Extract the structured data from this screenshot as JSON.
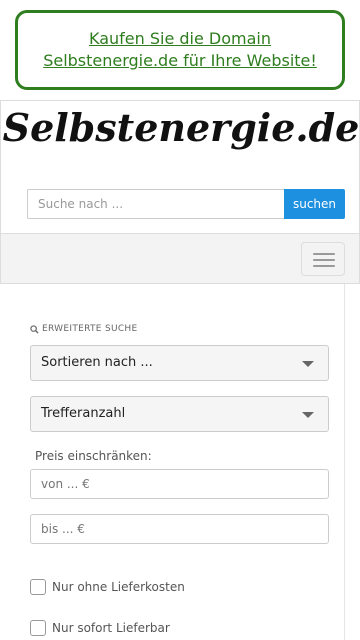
{
  "promo": {
    "text": "Kaufen Sie die Domain Selbstenergie.de für Ihre Website!"
  },
  "header": {
    "logo": "Selbstenergie.de",
    "search_placeholder": "Suche nach ...",
    "search_button": "suchen"
  },
  "navbar": {
    "toggle_icon": "hamburger-menu-icon"
  },
  "filters": {
    "section_label": "ERWEITERTE SUCHE",
    "section_icon": "search-icon",
    "sort_select": "Sortieren nach ...",
    "count_select": "Trefferanzahl",
    "price_label": "Preis einschränken:",
    "price_from_placeholder": "von ... €",
    "price_to_placeholder": "bis ... €",
    "checkbox_no_shipping": "Nur ohne Lieferkosten",
    "checkbox_instant": "Nur sofort Lieferbar"
  },
  "colors": {
    "promo_green": "#2e7d1e",
    "button_blue": "#1e90e0"
  }
}
